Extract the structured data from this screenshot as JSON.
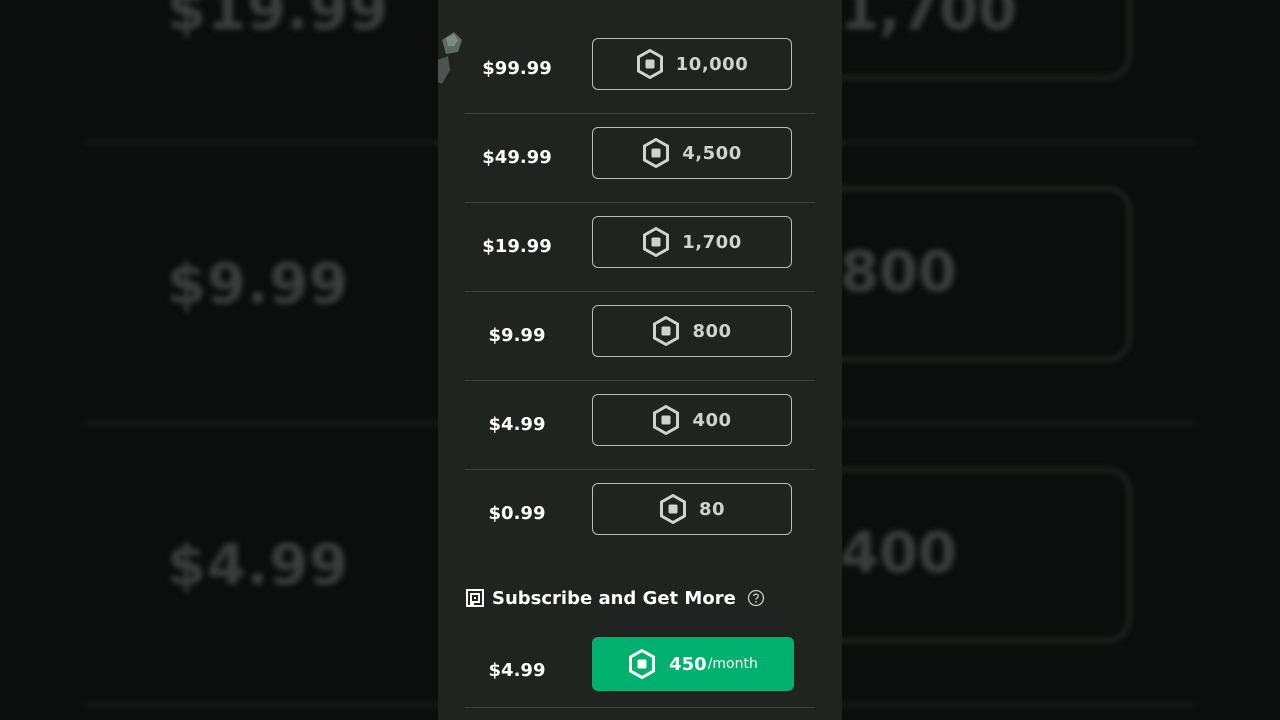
{
  "background": {
    "prices": [
      "$19.99",
      "$9.99",
      "$4.99"
    ],
    "amounts": [
      "1,700",
      "800",
      "400"
    ]
  },
  "packages": [
    {
      "price": "$99.99",
      "robux": "10,000"
    },
    {
      "price": "$49.99",
      "robux": "4,500"
    },
    {
      "price": "$19.99",
      "robux": "1,700"
    },
    {
      "price": "$9.99",
      "robux": "800"
    },
    {
      "price": "$4.99",
      "robux": "400"
    },
    {
      "price": "$0.99",
      "robux": "80"
    }
  ],
  "subscription": {
    "title": "Subscribe and Get More",
    "price": "$4.99",
    "robux": "450",
    "period": "/month"
  },
  "colors": {
    "panel": "#1f2420",
    "accent_green": "#00b06f",
    "button_border": "#b8bcb8"
  },
  "icons": {
    "robux": "robux-hexagon-icon",
    "subscription": "premium-icon",
    "help": "question-mark-circle-icon"
  }
}
